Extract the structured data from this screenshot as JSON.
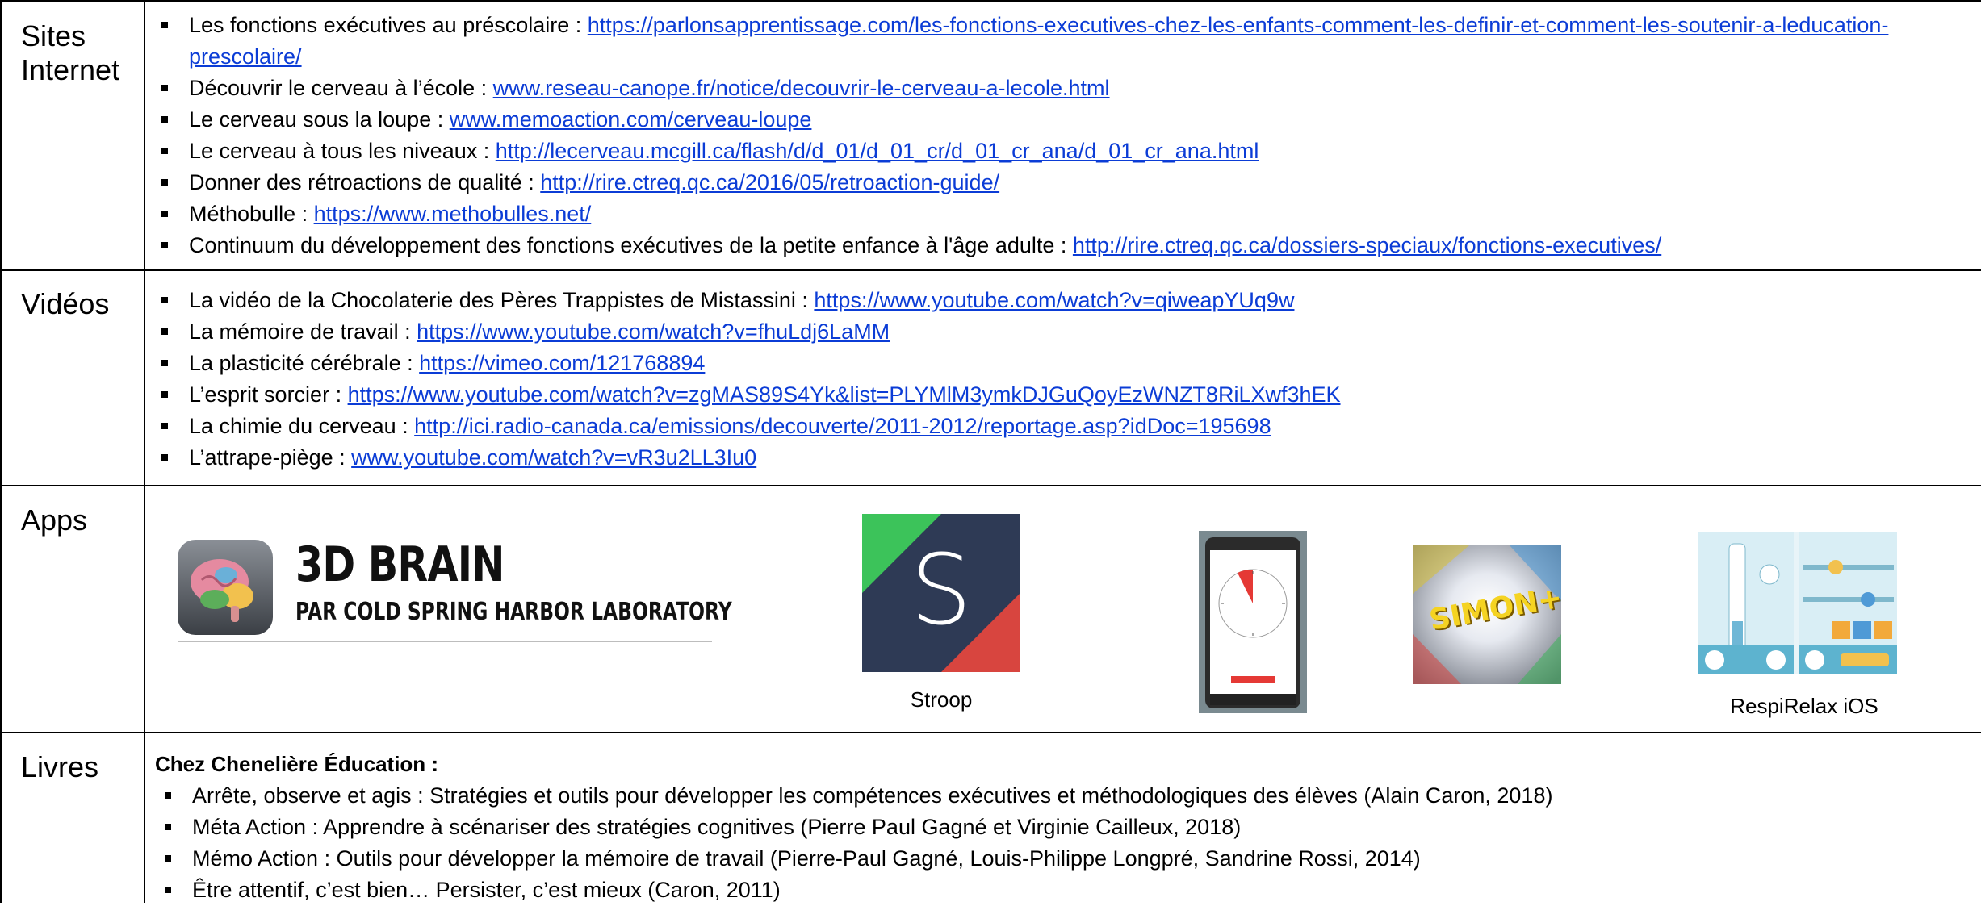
{
  "categories": {
    "sites": "Sites Internet",
    "videos": "Vidéos",
    "apps": "Apps",
    "books": "Livres"
  },
  "sites": [
    {
      "text": "Les fonctions exécutives au préscolaire : ",
      "url": "https://parlonsapprentissage.com/les-fonctions-executives-chez-les-enfants-comment-les-definir-et-comment-les-soutenir-a-leducation-prescolaire/"
    },
    {
      "text": "Découvrir le cerveau à l’école : ",
      "url": "www.reseau-canope.fr/notice/decouvrir-le-cerveau-a-lecole.html"
    },
    {
      "text": "Le cerveau sous la loupe : ",
      "url": "www.memoaction.com/cerveau-loupe"
    },
    {
      "text": "Le cerveau à tous les niveaux : ",
      "url": "http://lecerveau.mcgill.ca/flash/d/d_01/d_01_cr/d_01_cr_ana/d_01_cr_ana.html"
    },
    {
      "text": "Donner des rétroactions de qualité : ",
      "url": "http://rire.ctreq.qc.ca/2016/05/retroaction-guide/"
    },
    {
      "text": "Méthobulle : ",
      "url": "https://www.methobulles.net/"
    },
    {
      "text": "Continuum du développement des fonctions exécutives de la petite enfance à l'âge adulte : ",
      "url": "http://rire.ctreq.qc.ca/dossiers-speciaux/fonctions-executives/"
    }
  ],
  "videos": [
    {
      "text": "La vidéo de la Chocolaterie des Pères Trappistes de Mistassini : ",
      "url": "https://www.youtube.com/watch?v=qiweapYUq9w"
    },
    {
      "text": "La mémoire de travail : ",
      "url": "https://www.youtube.com/watch?v=fhuLdj6LaMM"
    },
    {
      "text": "La plasticité cérébrale : ",
      "url": "https://vimeo.com/121768894"
    },
    {
      "text": "L’esprit sorcier : ",
      "url": "https://www.youtube.com/watch?v=zgMAS89S4Yk&list=PLYMlM3ymkDJGuQoyEzWNZT8RiLXwf3hEK"
    },
    {
      "text": "La chimie du cerveau : ",
      "url": "http://ici.radio-canada.ca/emissions/decouverte/2011-2012/reportage.asp?idDoc=195698"
    },
    {
      "text": "L’attrape-piège : ",
      "url": "www.youtube.com/watch?v=vR3u2LL3Iu0"
    }
  ],
  "apps": {
    "brain_title": "3D BRAIN",
    "brain_subtitle": "PAR COLD SPRING HARBOR LABORATORY",
    "stroop_letter": "S",
    "stroop_caption": "Stroop",
    "simon_logo": "SIMON+",
    "respirelax_caption": "RespiRelax iOS"
  },
  "books": {
    "publisher": "Chez Chenelière Éducation :",
    "items": [
      "Arrête, observe et agis : Stratégies et outils pour développer les compétences exécutives et méthodologiques des élèves (Alain Caron, 2018)",
      "Méta Action : Apprendre à scénariser des stratégies cognitives (Pierre Paul Gagné et Virginie Cailleux, 2018)",
      "Mémo Action : Outils pour développer la mémoire de travail (Pierre-Paul Gagné, Louis-Philippe Longpré, Sandrine Rossi, 2014)",
      "Être attentif, c’est bien… Persister, c’est mieux (Caron, 2011)"
    ]
  },
  "colors": {
    "link": "#0b3cd6",
    "stroop_green": "#3cc35a",
    "stroop_navy": "#2e3a55",
    "stroop_red": "#d8453f"
  }
}
